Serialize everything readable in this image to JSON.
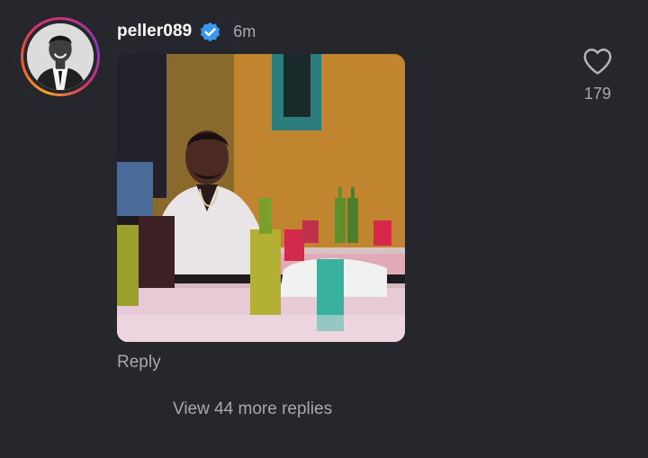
{
  "comment": {
    "username": "peller089",
    "timestamp": "6m",
    "reply_label": "Reply",
    "view_more_label": "View 44 more replies",
    "like_count": "179"
  },
  "icons": {
    "verified": "verified-badge-icon",
    "like": "heart-icon"
  },
  "colors": {
    "background": "#25272c",
    "verified_badge": "#3897f0",
    "secondary_text": "#a8a8ad"
  }
}
